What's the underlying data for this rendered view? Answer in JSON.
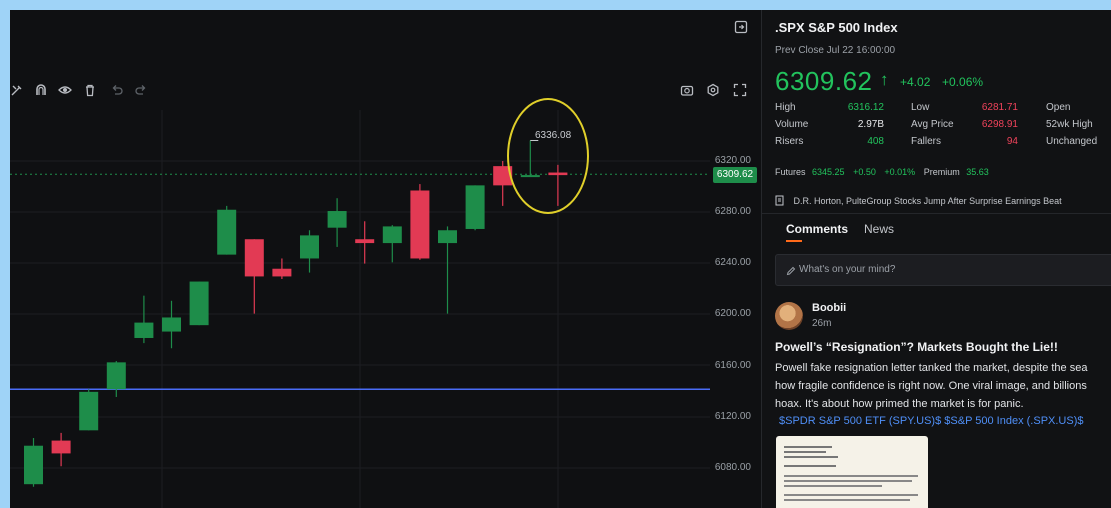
{
  "chart": {
    "price_ticks": [
      "6320.00",
      "6280.00",
      "6240.00",
      "6200.00",
      "6160.00",
      "6120.00",
      "6080.00"
    ],
    "last_price_tag": "6309.62",
    "highlight_label": "6336.08",
    "colors": {
      "up": "#1e8d4a",
      "down": "#e23a54",
      "horizontal_line": "#4a6cf7",
      "dotted_line": "#1e8d4a",
      "highlight": "#e0cf2a"
    },
    "toolbar_icons": [
      "draw-icon",
      "magnet-icon",
      "eye-icon",
      "trash-icon",
      "undo-icon",
      "redo-icon"
    ],
    "right_toolbar_icons": [
      "camera-icon",
      "settings-icon",
      "fullscreen-icon"
    ],
    "horizontal_line_price": 6142,
    "candles": [
      {
        "o": 6068,
        "h": 6104,
        "l": 6066,
        "c": 6098
      },
      {
        "o": 6102,
        "h": 6108,
        "l": 6082,
        "c": 6092
      },
      {
        "o": 6110,
        "h": 6142,
        "l": 6110,
        "c": 6140
      },
      {
        "o": 6142,
        "h": 6164,
        "l": 6136,
        "c": 6163
      },
      {
        "o": 6182,
        "h": 6215,
        "l": 6178,
        "c": 6194
      },
      {
        "o": 6187,
        "h": 6211,
        "l": 6174,
        "c": 6198
      },
      {
        "o": 6192,
        "h": 6226,
        "l": 6192,
        "c": 6226
      },
      {
        "o": 6247,
        "h": 6285,
        "l": 6247,
        "c": 6282
      },
      {
        "o": 6259,
        "h": 6259,
        "l": 6201,
        "c": 6230
      },
      {
        "o": 6236,
        "h": 6244,
        "l": 6228,
        "c": 6230
      },
      {
        "o": 6244,
        "h": 6266,
        "l": 6233,
        "c": 6262
      },
      {
        "o": 6268,
        "h": 6291,
        "l": 6253,
        "c": 6281
      },
      {
        "o": 6259,
        "h": 6273,
        "l": 6240,
        "c": 6256
      },
      {
        "o": 6256,
        "h": 6270,
        "l": 6241,
        "c": 6269
      },
      {
        "o": 6297,
        "h": 6302,
        "l": 6243,
        "c": 6244
      },
      {
        "o": 6256,
        "h": 6269,
        "l": 6201,
        "c": 6266
      },
      {
        "o": 6267,
        "h": 6301,
        "l": 6266,
        "c": 6301
      },
      {
        "o": 6316,
        "h": 6320,
        "l": 6285,
        "c": 6301
      },
      {
        "o": 6308,
        "h": 6336,
        "l": 6308,
        "c": 6309
      },
      {
        "o": 6311,
        "h": 6317,
        "l": 6285,
        "c": 6309
      }
    ]
  },
  "quote": {
    "symbol_title": ".SPX  S&P 500 Index",
    "prev_close": "Prev Close Jul 22 16:00:00",
    "price": "6309.62",
    "change": "+4.02",
    "change_pct": "+0.06%",
    "stats": [
      {
        "label": "High",
        "value": "6316.12",
        "color": "green"
      },
      {
        "label": "Low",
        "value": "6281.71",
        "color": "red"
      },
      {
        "label": "Open",
        "value": "",
        "color": "white"
      },
      {
        "label": "Volume",
        "value": "2.97B",
        "color": "white"
      },
      {
        "label": "Avg Price",
        "value": "6298.91",
        "color": "red"
      },
      {
        "label": "52wk High",
        "value": "",
        "color": "white"
      },
      {
        "label": "Risers",
        "value": "408",
        "color": "green"
      },
      {
        "label": "Fallers",
        "value": "94",
        "color": "red"
      },
      {
        "label": "Unchanged",
        "value": "",
        "color": "white"
      }
    ],
    "futures_label": "Futures",
    "futures_price": "6345.25",
    "futures_change": "+0.50",
    "futures_pct": "+0.01%",
    "premium_label": "Premium",
    "premium_value": "35.63",
    "headline": "D.R. Horton, PulteGroup Stocks Jump After Surprise Earnings Beat"
  },
  "tabs": {
    "comments": "Comments",
    "news": "News"
  },
  "compose_placeholder": "What's on your mind?",
  "post": {
    "user": "Boobii",
    "time": "26m",
    "title": "Powell’s “Resignation”? Markets Bought the Lie!!",
    "lines": [
      "Powell fake resignation letter tanked the market, despite the sea",
      "how fragile confidence is right now. One viral image, and billions",
      "hoax. It's about how primed the market is for panic."
    ],
    "links": "$SPDR S&P 500 ETF (SPY.US)$  $S&P 500 Index (.SPX.US)$"
  }
}
